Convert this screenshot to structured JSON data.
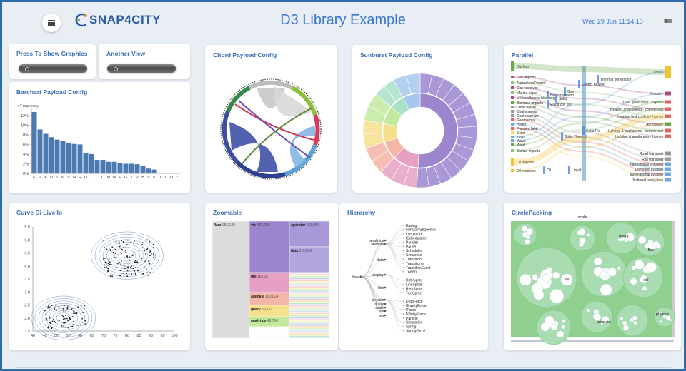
{
  "header": {
    "title": "D3 Library Example",
    "logo_text": "SNAP4CITY",
    "datetime": "Wed 29 Jun 11:14:10"
  },
  "widgets": {
    "press_graphics": {
      "title": "Press To Show Graphics"
    },
    "another_view": {
      "title": "Another View"
    },
    "barchart": {
      "title": "Barchart Payload Config",
      "ylabel": "↑ Frequency"
    },
    "chord": {
      "title": "Chord Payload Config"
    },
    "sunburst": {
      "title": "Sunburst Payload Config"
    },
    "parallel": {
      "title": "Parallel",
      "left_labels": [
        "Nuclear",
        "Gas imports",
        "Agricultural 'waste'",
        "Gas reserves",
        "Marine algae",
        "UK land based bioenergy",
        "Biomass imports",
        "Other waste",
        "Coal imports",
        "Coal reserves",
        "Geothermal",
        "Hydro",
        "Pumped heat",
        "Solar",
        "Tidal",
        "Wave",
        "Wind",
        "Biofuel imports",
        "Oil imports",
        "Oil reserves"
      ],
      "right_labels": [
        "Losses",
        "Industry",
        "Over generation / exports",
        "Heating and cooling - commercial",
        "Heating and cooling - homes",
        "Agriculture",
        "Lighting & appliances - commercial",
        "Lighting & appliances - homes",
        "Road transport",
        "Rail transport",
        "International shipping",
        "Domestic aviation",
        "International aviation",
        "National navigation"
      ],
      "mid_labels": [
        "Thermal generation",
        "District heating",
        "Gas",
        "Bio-conversion",
        "Solid",
        "Electricity grid",
        "Solar PV",
        "Solar Thermal",
        "Oil",
        "Liquid"
      ]
    },
    "curve": {
      "title": "Curve Di Livello"
    },
    "zoomable": {
      "title": "Zoomable",
      "cells": [
        {
          "name": "flare",
          "value": "956,129"
        },
        {
          "name": "vis",
          "value": "432,029"
        },
        {
          "name": "operator",
          "value": "183,967"
        },
        {
          "name": "data",
          "value": "116,693"
        },
        {
          "name": "util",
          "value": "165,157"
        },
        {
          "name": "animate",
          "value": "100,024"
        },
        {
          "name": "query",
          "value": "89,721"
        },
        {
          "name": "analytics",
          "value": "48,716"
        }
      ]
    },
    "hierarchy": {
      "title": "Hierarchy",
      "root": "flare",
      "level1": [
        "analytics",
        "animate",
        "data",
        "display",
        "flex",
        "physics",
        "query",
        "scale",
        "util",
        "vis"
      ],
      "leaves": [
        "Easing",
        "FunctionSequence",
        "interpolate",
        "ISchedulable",
        "Parallel",
        "Pause",
        "Scheduler",
        "Sequence",
        "Transition",
        "Transitioner",
        "TransitionEvent",
        "Tween",
        "DirtySprite",
        "LineSprite",
        "RectSprite",
        "TextSprite",
        "DragForce",
        "GravityForce",
        "IForce",
        "NBodyForce",
        "Particle",
        "Simulation",
        "Spring",
        "SpringForce"
      ]
    },
    "circlepacking": {
      "title": "CirclePacking",
      "labels": [
        "query",
        "flex",
        "vis",
        "util",
        "animate",
        "physics",
        "scale"
      ]
    }
  },
  "chart_data": [
    {
      "type": "bar",
      "title": "Barchart Payload Config",
      "ylabel": "↑ Frequency",
      "categories": [
        "E",
        "T",
        "A",
        "O",
        "I",
        "N",
        "S",
        "H",
        "R",
        "D",
        "L",
        "C",
        "U",
        "M",
        "W",
        "F",
        "G",
        "Y",
        "P",
        "B",
        "V",
        "K",
        "J",
        "X",
        "Q",
        "Z"
      ],
      "values": [
        12.7,
        9.1,
        8.2,
        7.5,
        7.0,
        6.7,
        6.3,
        6.1,
        6.0,
        4.3,
        4.0,
        2.8,
        2.8,
        2.4,
        2.4,
        2.2,
        2.0,
        2.0,
        1.9,
        1.5,
        1.0,
        0.8,
        0.15,
        0.15,
        0.1,
        0.07
      ],
      "yticks": [
        "0%",
        "2%",
        "4%",
        "6%",
        "8%",
        "10%",
        "12%"
      ],
      "ylim": [
        0,
        13
      ]
    },
    {
      "type": "scatter",
      "title": "Curve Di Livello",
      "xticks": [
        "40",
        "45",
        "50",
        "55",
        "60",
        "65",
        "70",
        "75",
        "80",
        "85",
        "90",
        "95",
        "100"
      ],
      "yticks": [
        "1.5",
        "2.0",
        "2.5",
        "3.0",
        "3.5",
        "4.0",
        "4.5",
        "5.0",
        "5.5"
      ],
      "xlim": [
        40,
        100
      ],
      "ylim": [
        1.5,
        5.5
      ]
    }
  ],
  "colors": {
    "accent": "#3a7ad1",
    "bar": "#4d79b1",
    "sunburst": [
      "#9c87cf",
      "#e6a0c4",
      "#f4b6a6",
      "#f7e08c",
      "#c2e99e",
      "#a8e1c8",
      "#a6c8ef"
    ],
    "circle_bg": "#8fd08f"
  }
}
